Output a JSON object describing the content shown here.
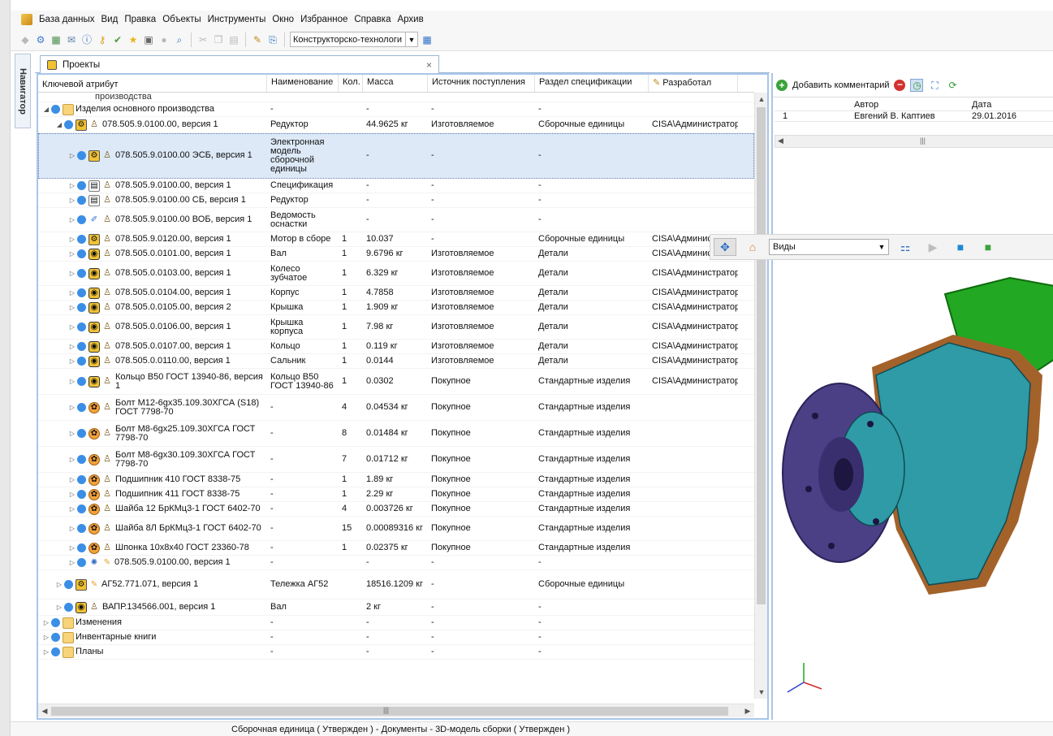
{
  "menu": [
    "База данных",
    "Вид",
    "Правка",
    "Объекты",
    "Инструменты",
    "Окно",
    "Избранное",
    "Справка",
    "Архив"
  ],
  "toolbar": {
    "combo_value": "Конструкторско-технологи"
  },
  "navigator_label": "Навигатор",
  "doc_tab": {
    "label": "Проекты",
    "close": "×"
  },
  "table": {
    "columns": [
      "Ключевой атрибут",
      "Наименование",
      "Кол.",
      "Масса",
      "Источник поступления",
      "Раздел спецификации",
      "Разработал"
    ],
    "partial_top_text": "производства",
    "rows": [
      {
        "indent": 0,
        "icon": "folder",
        "person": false,
        "key": "Изделия основного производства",
        "name": "-",
        "qty": "",
        "mass": "-",
        "source": "-",
        "section": "-",
        "author": "",
        "h": 18,
        "expanded": true
      },
      {
        "indent": 1,
        "icon": "asm",
        "person": true,
        "key": "078.505.9.0100.00, версия 1",
        "name": "Редуктор",
        "qty": "",
        "mass": "44.9625 кг",
        "source": "Изготовляемое",
        "section": "Сборочные единицы",
        "author": "CISA\\Администратор",
        "h": 20,
        "expanded": true
      },
      {
        "indent": 2,
        "icon": "asm",
        "person": true,
        "key": "078.505.9.0100.00 ЭСБ, версия 1",
        "name": "Электронная модель сборочной единицы",
        "qty": "",
        "mass": "-",
        "source": "-",
        "section": "-",
        "author": "",
        "h": 56,
        "selected": true
      },
      {
        "indent": 2,
        "icon": "doc",
        "person": true,
        "key": "078.505.9.0100.00, версия 1",
        "name": "Спецификация",
        "qty": "",
        "mass": "-",
        "source": "-",
        "section": "-",
        "author": "",
        "h": 18
      },
      {
        "indent": 2,
        "icon": "doc",
        "person": true,
        "key": "078.505.9.0100.00 СБ, версия 1",
        "name": "Редуктор",
        "qty": "",
        "mass": "-",
        "source": "-",
        "section": "-",
        "author": "",
        "h": 18
      },
      {
        "indent": 2,
        "icon": "ref",
        "person": true,
        "key": "078.505.9.0100.00 ВОБ, версия 1",
        "name": "Ведомость оснастки",
        "qty": "",
        "mass": "-",
        "source": "-",
        "section": "-",
        "author": "",
        "h": 30
      },
      {
        "indent": 2,
        "icon": "asm",
        "person": true,
        "key": "078.505.9.0120.00, версия 1",
        "name": "Мотор в сборе",
        "qty": "1",
        "mass": "10.037",
        "source": "-",
        "section": "Сборочные единицы",
        "author": "CISA\\Администратор",
        "h": 18
      },
      {
        "indent": 2,
        "icon": "part",
        "person": true,
        "key": "078.505.0.0101.00, версия 1",
        "name": "Вал",
        "qty": "1",
        "mass": "9.6796 кг",
        "source": "Изготовляемое",
        "section": "Детали",
        "author": "CISA\\Администратор",
        "h": 18
      },
      {
        "indent": 2,
        "icon": "part",
        "person": true,
        "key": "078.505.0.0103.00, версия 1",
        "name": "Колесо зубчатое",
        "qty": "1",
        "mass": "6.329 кг",
        "source": "Изготовляемое",
        "section": "Детали",
        "author": "CISA\\Администратор",
        "h": 30
      },
      {
        "indent": 2,
        "icon": "part",
        "person": true,
        "key": "078.505.0.0104.00, версия 1",
        "name": "Корпус",
        "qty": "1",
        "mass": "4.7858",
        "source": "Изготовляемое",
        "section": "Детали",
        "author": "CISA\\Администратор",
        "h": 18
      },
      {
        "indent": 2,
        "icon": "part",
        "person": true,
        "key": "078.505.0.0105.00, версия 2",
        "name": "Крышка",
        "qty": "1",
        "mass": "1.909 кг",
        "source": "Изготовляемое",
        "section": "Детали",
        "author": "CISA\\Администратор",
        "h": 18
      },
      {
        "indent": 2,
        "icon": "part",
        "person": true,
        "key": "078.505.0.0106.00, версия 1",
        "name": "Крышка корпуса",
        "qty": "1",
        "mass": "7.98 кг",
        "source": "Изготовляемое",
        "section": "Детали",
        "author": "CISA\\Администратор",
        "h": 30
      },
      {
        "indent": 2,
        "icon": "part",
        "person": true,
        "key": "078.505.0.0107.00, версия 1",
        "name": "Кольцо",
        "qty": "1",
        "mass": "0.119 кг",
        "source": "Изготовляемое",
        "section": "Детали",
        "author": "CISA\\Администратор",
        "h": 18
      },
      {
        "indent": 2,
        "icon": "part",
        "person": true,
        "key": "078.505.0.0110.00, версия 1",
        "name": "Сальник",
        "qty": "1",
        "mass": "0.0144",
        "source": "Изготовляемое",
        "section": "Детали",
        "author": "CISA\\Администратор",
        "h": 18
      },
      {
        "indent": 2,
        "icon": "part",
        "person": true,
        "key": "Кольцо В50 ГОСТ 13940-86, версия 1",
        "name": "Кольцо В50 ГОСТ 13940-86",
        "qty": "1",
        "mass": "0.0302",
        "source": "Покупное",
        "section": "Стандартные изделия",
        "author": "CISA\\Администратор",
        "h": 32,
        "wrap": true
      },
      {
        "indent": 2,
        "icon": "std",
        "person": true,
        "key": "Болт М12-6gх35.109.30ХГСА (S18) ГОСТ 7798-70",
        "name": "-",
        "qty": "4",
        "mass": "0.04534 кг",
        "source": "Покупное",
        "section": "Стандартные изделия",
        "author": "",
        "h": 32,
        "wrap": true
      },
      {
        "indent": 2,
        "icon": "std",
        "person": true,
        "key": "Болт М8-6gх25.109.30ХГСА ГОСТ 7798-70",
        "name": "-",
        "qty": "8",
        "mass": "0.01484 кг",
        "source": "Покупное",
        "section": "Стандартные изделия",
        "author": "",
        "h": 32,
        "wrap": true
      },
      {
        "indent": 2,
        "icon": "std",
        "person": true,
        "key": "Болт М8-6gх30.109.30ХГСА ГОСТ 7798-70",
        "name": "-",
        "qty": "7",
        "mass": "0.01712 кг",
        "source": "Покупное",
        "section": "Стандартные изделия",
        "author": "",
        "h": 32,
        "wrap": true
      },
      {
        "indent": 2,
        "icon": "std",
        "person": true,
        "key": "Подшипник 410 ГОСТ 8338-75",
        "name": "-",
        "qty": "1",
        "mass": "1.89 кг",
        "source": "Покупное",
        "section": "Стандартные изделия",
        "author": "",
        "h": 18
      },
      {
        "indent": 2,
        "icon": "std",
        "person": true,
        "key": "Подшипник 411 ГОСТ 8338-75",
        "name": "-",
        "qty": "1",
        "mass": "2.29 кг",
        "source": "Покупное",
        "section": "Стандартные изделия",
        "author": "",
        "h": 18
      },
      {
        "indent": 2,
        "icon": "std",
        "person": true,
        "key": "Шайба 12 БрКМц3-1 ГОСТ 6402-70",
        "name": "-",
        "qty": "4",
        "mass": "0.003726 кг",
        "source": "Покупное",
        "section": "Стандартные изделия",
        "author": "",
        "h": 18
      },
      {
        "indent": 2,
        "icon": "std",
        "person": true,
        "key": "Шайба 8Л БрКМц3-1 ГОСТ 6402-70",
        "name": "-",
        "qty": "15",
        "mass": "0.00089316 кг",
        "source": "Покупное",
        "section": "Стандартные изделия",
        "author": "",
        "h": 30,
        "wrap": true
      },
      {
        "indent": 2,
        "icon": "std",
        "person": true,
        "key": "Шпонка 10х8х40 ГОСТ 23360-78",
        "name": "-",
        "qty": "1",
        "mass": "0.02375 кг",
        "source": "Покупное",
        "section": "Стандартные изделия",
        "author": "",
        "h": 18
      },
      {
        "indent": 2,
        "icon": "gear",
        "person": false,
        "pencil": true,
        "key": "078.505.9.0100.00, версия 1",
        "name": "-",
        "qty": "",
        "mass": "-",
        "source": "-",
        "section": "-",
        "author": "",
        "h": 18
      },
      {
        "indent": 1,
        "icon": "asm",
        "person": false,
        "pencil": true,
        "key": "АГ52.771.071, версия 1",
        "name": "Тележка АГ52",
        "qty": "",
        "mass": "18516.1209 кг",
        "source": "-",
        "section": "Сборочные единицы",
        "author": "",
        "h": 36
      },
      {
        "indent": 1,
        "icon": "part",
        "person": true,
        "key": "ВАПР.134566.001, версия 1",
        "name": "Вал",
        "qty": "",
        "mass": "2 кг",
        "source": "-",
        "section": "-",
        "author": "",
        "h": 20
      },
      {
        "indent": 0,
        "icon": "folder",
        "person": false,
        "key": "Изменения",
        "name": "-",
        "qty": "",
        "mass": "-",
        "source": "-",
        "section": "-",
        "author": "",
        "h": 18
      },
      {
        "indent": 0,
        "icon": "folder",
        "person": false,
        "key": "Инвентарные книги",
        "name": "-",
        "qty": "",
        "mass": "-",
        "source": "-",
        "section": "-",
        "author": "",
        "h": 18
      },
      {
        "indent": 0,
        "icon": "folder",
        "person": false,
        "key": "Планы",
        "name": "-",
        "qty": "",
        "mass": "-",
        "source": "-",
        "section": "-",
        "author": "",
        "h": 18
      }
    ]
  },
  "comments": {
    "add_label": "Добавить комментарий",
    "columns": [
      "Автор",
      "Дата"
    ],
    "rows": [
      {
        "num": "1",
        "author": "Евгений В. Каптиев",
        "date": "29.01.2016"
      }
    ]
  },
  "viewer": {
    "views_combo": "Виды"
  },
  "status": "Сборочная единица ( Утвержден ) - Документы - 3D-модель сборки ( Утвержден )"
}
